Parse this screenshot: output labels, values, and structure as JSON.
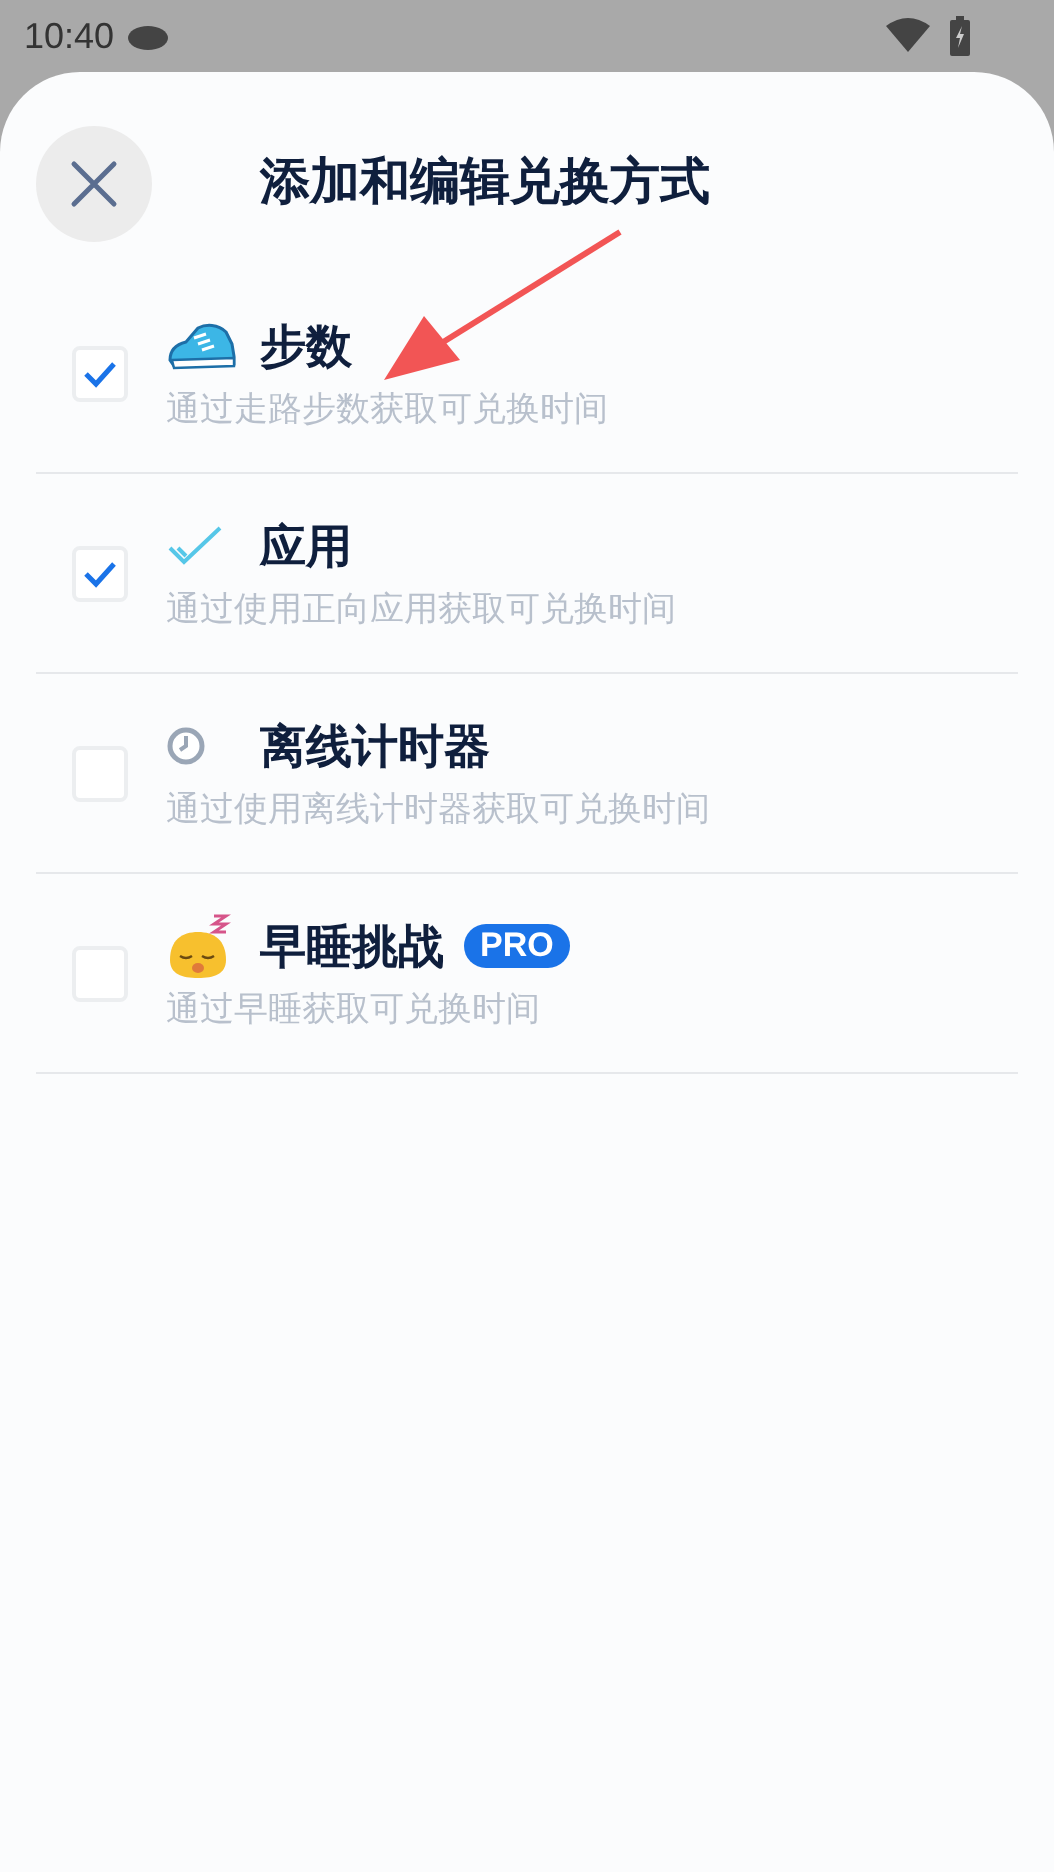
{
  "status_bar": {
    "time": "10:40"
  },
  "sheet": {
    "title": "添加和编辑兑换方式"
  },
  "methods": [
    {
      "title": "步数",
      "description": "通过走路步数获取可兑换时间",
      "checked": true
    },
    {
      "title": "应用",
      "description": "通过使用正向应用获取可兑换时间",
      "checked": true
    },
    {
      "title": "离线计时器",
      "description": "通过使用离线计时器获取可兑换时间",
      "checked": false
    },
    {
      "title": "早睡挑战",
      "badge": "PRO",
      "description": "通过早睡获取可兑换时间",
      "checked": false
    }
  ]
}
